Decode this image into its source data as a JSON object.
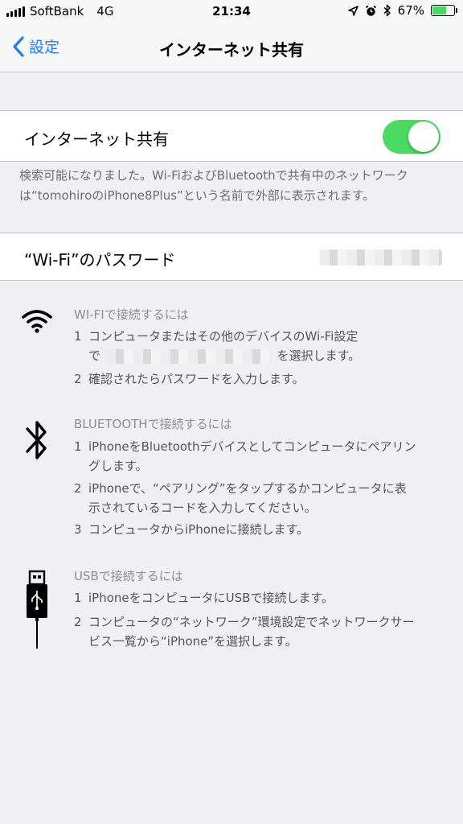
{
  "status": {
    "carrier": "SoftBank",
    "network": "4G",
    "time": "21:34",
    "battery_percent": "67%",
    "battery_level": 0.67,
    "icons": [
      "signal-icon",
      "location-arrow-icon",
      "alarm-icon",
      "bluetooth-icon",
      "battery-icon"
    ]
  },
  "nav": {
    "back_label": "設定",
    "title": "インターネット共有"
  },
  "hotspot": {
    "label": "インターネット共有",
    "enabled": true,
    "toggle_color": "#4cd964",
    "footer_line1": "検索可能になりました。Wi-FiおよびBluetoothで共有中のネットワーク",
    "footer_line2": "は“tomohiroのiPhone8Plus”という名前で外部に表示されます。"
  },
  "password": {
    "label": "“Wi-Fi”のパスワード"
  },
  "wifi_section": {
    "icon": "wifi-icon",
    "title": "WI-FIで接続するには",
    "step1_num": "1",
    "step1_line1": "コンピュータまたはその他のデバイスのWi-Fi設定",
    "step1_prefix": "で",
    "step1_suffix": "を選択します。",
    "step2_num": "2",
    "step2": "確認されたらパスワードを入力します。"
  },
  "bt_section": {
    "icon": "bluetooth-icon",
    "title": "BLUETOOTHで接続するには",
    "step1_num": "1",
    "step1_line1": "iPhoneをBluetoothデバイスとしてコンピュータにペアリン",
    "step1_line2": "グします。",
    "step2_num": "2",
    "step2_line1": "iPhoneで、“ペアリング”をタップするかコンピュータに表",
    "step2_line2": "示されているコードを入力してください。",
    "step3_num": "3",
    "step3": "コンピュータからiPhoneに接続します。"
  },
  "usb_section": {
    "icon": "usb-cable-icon",
    "title": "USBで接続するには",
    "step1_num": "1",
    "step1": "iPhoneをコンピュータにUSBで接続します。",
    "step2_num": "2",
    "step2_line1": "コンピュータの“ネットワーク”環境設定でネットワークサー",
    "step2_line2": "ビス一覧から“iPhone”を選択します。"
  }
}
